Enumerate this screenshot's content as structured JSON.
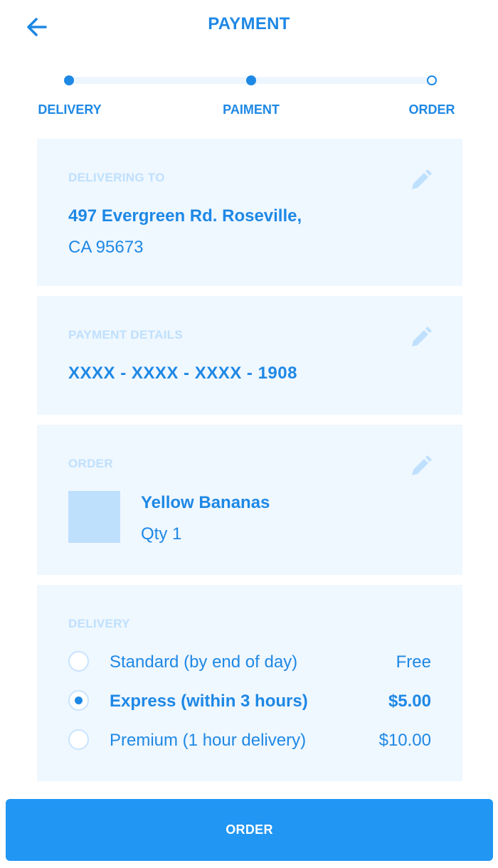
{
  "header": {
    "title": "PAYMENT",
    "back_icon": "arrow-left-icon"
  },
  "stepper": {
    "steps": [
      {
        "label": "DELIVERY",
        "state": "done"
      },
      {
        "label": "PAIMENT",
        "state": "done"
      },
      {
        "label": "ORDER",
        "state": "pending"
      }
    ]
  },
  "delivering_to": {
    "label": "DELIVERING TO",
    "address_line1": "497 Evergreen Rd. Roseville,",
    "address_line2": "CA 95673",
    "edit_icon": "pencil-icon"
  },
  "payment_details": {
    "label": "PAYMENT DETAILS",
    "card_number": "XXXX - XXXX - XXXX - 1908",
    "edit_icon": "pencil-icon"
  },
  "order": {
    "label": "ORDER",
    "item_name": "Yellow Bananas",
    "item_qty": "Qty 1",
    "edit_icon": "pencil-icon"
  },
  "delivery": {
    "label": "DELIVERY",
    "options": [
      {
        "label": "Standard (by end of day)",
        "price": "Free",
        "selected": false
      },
      {
        "label": "Express (within 3 hours)",
        "price": "$5.00",
        "selected": true
      },
      {
        "label": "Premium (1 hour delivery)",
        "price": "$10.00",
        "selected": false
      }
    ]
  },
  "order_button": {
    "label": "ORDER"
  },
  "colors": {
    "accent": "#1e88e5",
    "button": "#2196f3",
    "card_bg": "#eff7ff",
    "muted": "#bfe0fd"
  }
}
